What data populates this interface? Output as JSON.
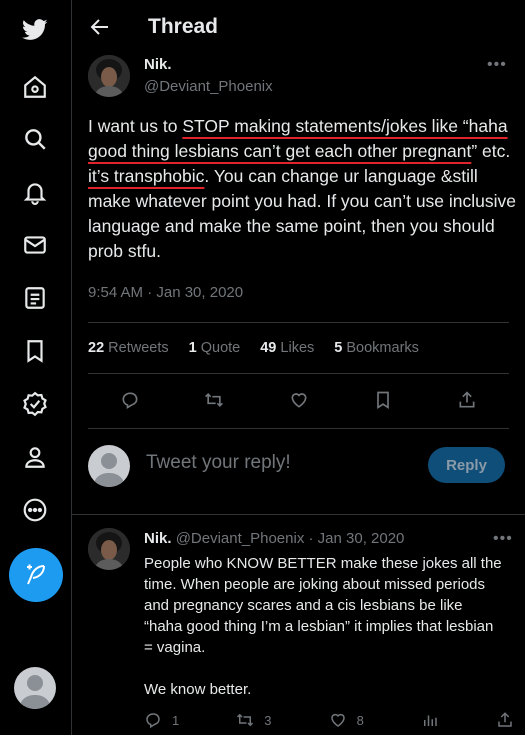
{
  "header": {
    "title": "Thread"
  },
  "tweet": {
    "author_name": "Nik.",
    "author_handle": "@Deviant_Phoenix",
    "text_parts": [
      "I want us to ",
      "STOP making statements/jokes like “haha good thing lesbians can’t get each other pregnant",
      "” etc. ",
      "it’s transphobic",
      ". You can change ur language &still make whatever point you had. If you can’t use inclusive language and make the same point, then you should prob stfu."
    ],
    "timestamp": "9:54 AM · Jan 30, 2020",
    "stats": {
      "retweets_count": "22",
      "retweets_label": "Retweets",
      "quotes_count": "1",
      "quotes_label": "Quote",
      "likes_count": "49",
      "likes_label": "Likes",
      "bookmarks_count": "5",
      "bookmarks_label": "Bookmarks"
    }
  },
  "reply_box": {
    "placeholder": "Tweet your reply!",
    "button_label": "Reply"
  },
  "reply_tweet": {
    "author_name": "Nik.",
    "meta": "@Deviant_Phoenix · Jan 30, 2020",
    "text": "People who KNOW BETTER make these jokes all the time. When people are joking about missed periods and pregnancy scares and a cis lesbians be like “haha good thing I’m a lesbian” it implies that lesbian = vagina.\n\nWe know better.",
    "replies": "1",
    "retweets": "3",
    "likes": "8"
  },
  "colors": {
    "accent": "#1d9bf0",
    "underline": "#e0242c",
    "muted": "#71767b"
  },
  "icons": [
    "twitter-logo-icon",
    "home-icon",
    "search-icon",
    "notifications-icon",
    "messages-icon",
    "lists-icon",
    "bookmarks-icon",
    "verified-icon",
    "profile-icon",
    "more-icon",
    "compose-icon"
  ]
}
